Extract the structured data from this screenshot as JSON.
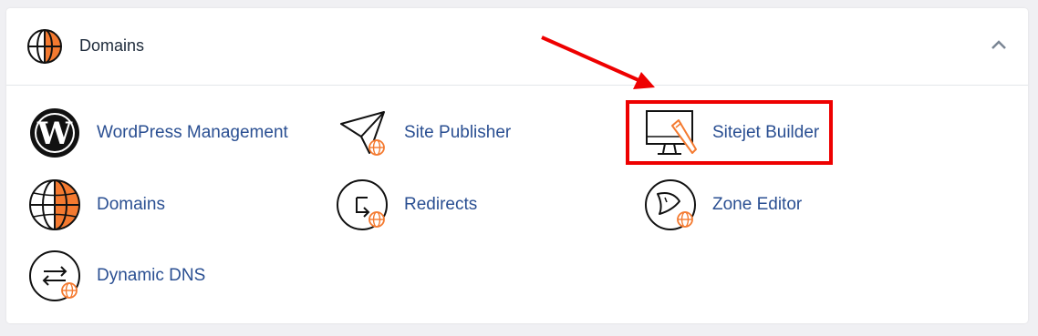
{
  "section": {
    "title": "Domains",
    "header_icon": "globe-icon",
    "collapse_icon": "chevron-up-icon"
  },
  "items": [
    {
      "label": "WordPress Management",
      "icon": "wordpress-icon"
    },
    {
      "label": "Site Publisher",
      "icon": "paper-plane-globe-icon"
    },
    {
      "label": "Sitejet Builder",
      "icon": "monitor-pencil-icon"
    },
    {
      "label": "Domains",
      "icon": "globe-icon"
    },
    {
      "label": "Redirects",
      "icon": "redirect-globe-icon"
    },
    {
      "label": "Zone Editor",
      "icon": "rocket-globe-icon"
    },
    {
      "label": "Dynamic DNS",
      "icon": "swap-arrows-globe-icon"
    }
  ],
  "colors": {
    "accent": "#f47a30",
    "link": "#2a4f92",
    "annotation": "#ee0000"
  }
}
